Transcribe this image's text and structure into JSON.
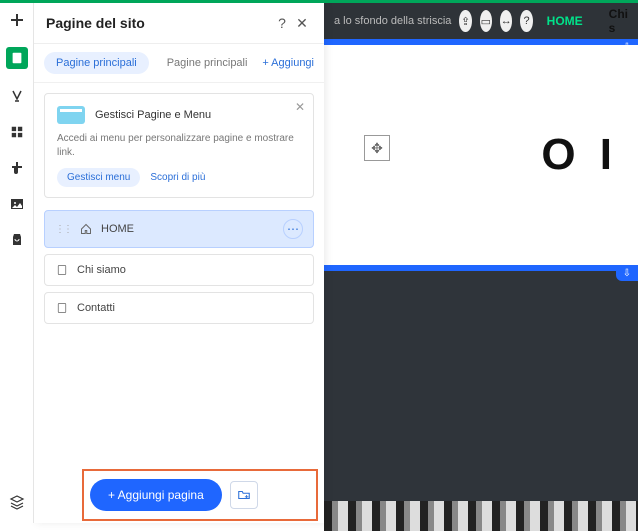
{
  "panel": {
    "title": "Pagine del sito",
    "pill": "Pagine principali",
    "sub_label": "Pagine principali",
    "add_link": "+ Aggiungi"
  },
  "info_card": {
    "title": "Gestisci Pagine e Menu",
    "desc": "Accedi ai menu per personalizzare pagine e mostrare link.",
    "manage_btn": "Gestisci menu",
    "learn_link": "Scopri di più"
  },
  "pages": [
    {
      "label": "HOME",
      "selected": true,
      "icon": "home"
    },
    {
      "label": "Chi siamo",
      "selected": false,
      "icon": "page"
    },
    {
      "label": "Contatti",
      "selected": false,
      "icon": "page"
    }
  ],
  "footer": {
    "add_page": "+ Aggiungi pagina"
  },
  "canvas": {
    "topbar_text": "a lo sfondo della striscia",
    "nav_home": "HOME",
    "nav_chi": "Chi s",
    "hero_text": "O I"
  }
}
